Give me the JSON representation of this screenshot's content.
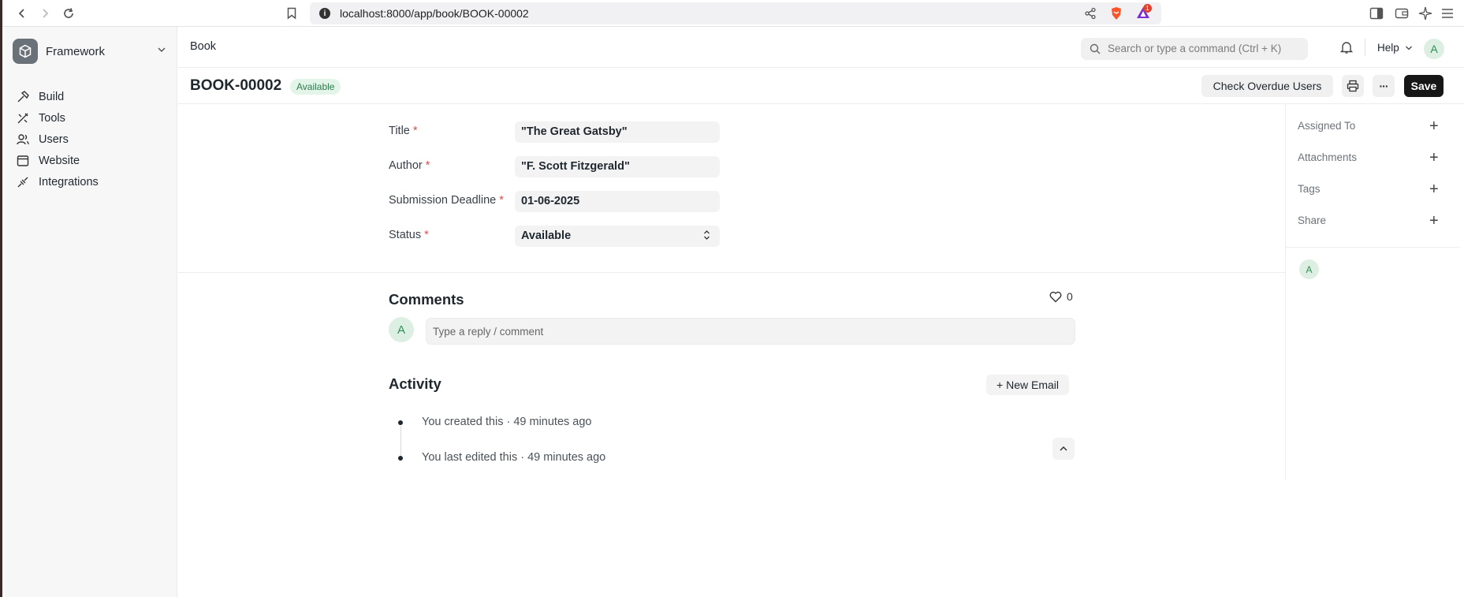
{
  "browser": {
    "url": "localhost:8000/app/book/BOOK-00002",
    "notification_count": "1"
  },
  "sidebar": {
    "app_name": "Framework",
    "items": [
      {
        "label": "Build",
        "icon": "hammer-icon"
      },
      {
        "label": "Tools",
        "icon": "tools-icon"
      },
      {
        "label": "Users",
        "icon": "users-icon"
      },
      {
        "label": "Website",
        "icon": "website-icon"
      },
      {
        "label": "Integrations",
        "icon": "integrations-icon"
      }
    ]
  },
  "topbar": {
    "breadcrumb": "Book",
    "search_placeholder": "Search or type a command (Ctrl + K)",
    "help_label": "Help",
    "avatar_initial": "A"
  },
  "header": {
    "doc_name": "BOOK-00002",
    "status_badge": "Available",
    "check_overdue_label": "Check Overdue Users",
    "more_label": "···",
    "save_label": "Save"
  },
  "form": {
    "fields": [
      {
        "label": "Title",
        "value": "\"The Great Gatsby\""
      },
      {
        "label": "Author",
        "value": "\"F. Scott Fitzgerald\""
      },
      {
        "label": "Submission Deadline",
        "value": "01-06-2025"
      },
      {
        "label": "Status",
        "value": "Available"
      }
    ],
    "required_mark": "*"
  },
  "right_sidebar": {
    "items": [
      "Assigned To",
      "Attachments",
      "Tags",
      "Share"
    ],
    "viewer_initial": "A"
  },
  "comments": {
    "title": "Comments",
    "like_count": "0",
    "avatar_initial": "A",
    "placeholder": "Type a reply / comment"
  },
  "activity": {
    "title": "Activity",
    "new_email_label": "+ New Email",
    "entries": [
      "You created this · 49 minutes ago",
      "You last edited this · 49 minutes ago"
    ]
  },
  "colors": {
    "accent_dark": "#171717",
    "badge_green_bg": "#e3f5e9",
    "badge_green_text": "#2d7a4a",
    "required_red": "#e24c4c"
  }
}
